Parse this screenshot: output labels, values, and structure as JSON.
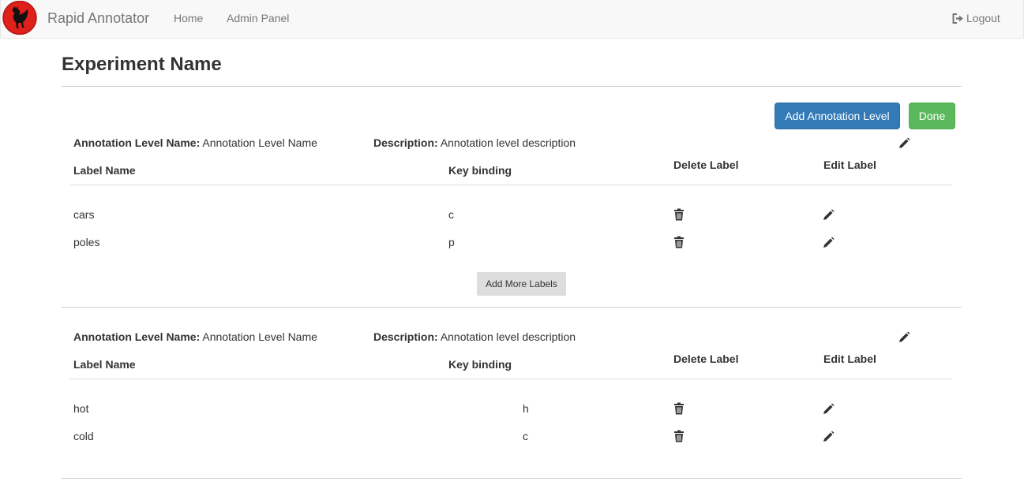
{
  "navbar": {
    "brand": "Rapid Annotator",
    "links": [
      "Home",
      "Admin Panel"
    ],
    "logout": "Logout"
  },
  "page": {
    "title": "Experiment Name",
    "add_level_button": "Add Annotation Level",
    "done_button": "Done",
    "add_more_labels_button": "Add More Labels"
  },
  "levels": [
    {
      "name_label": "Annotation Level Name:",
      "name": "Annotation Level Name",
      "desc_label": "Description:",
      "description": "Annotation level description",
      "headers": {
        "label": "Label Name",
        "key": "Key binding",
        "delete": "Delete Label",
        "edit": "Edit Label"
      },
      "rows": [
        {
          "label": "cars",
          "key": "c"
        },
        {
          "label": "poles",
          "key": "p"
        }
      ]
    },
    {
      "name_label": "Annotation Level Name:",
      "name": "Annotation Level Name",
      "desc_label": "Description:",
      "description": "Annotation level description",
      "headers": {
        "label": "Label Name",
        "key": "Key binding",
        "delete": "Delete Label",
        "edit": "Edit Label"
      },
      "rows": [
        {
          "label": "hot",
          "key": "h"
        },
        {
          "label": "cold",
          "key": "c"
        }
      ]
    }
  ],
  "icons": {
    "logo": "rooster-logo-icon",
    "logout": "logout-icon",
    "edit": "pencil-icon",
    "delete": "trash-icon"
  },
  "colors": {
    "primary": "#337ab7",
    "success": "#5cb85c",
    "logo_red": "#e0201b"
  }
}
